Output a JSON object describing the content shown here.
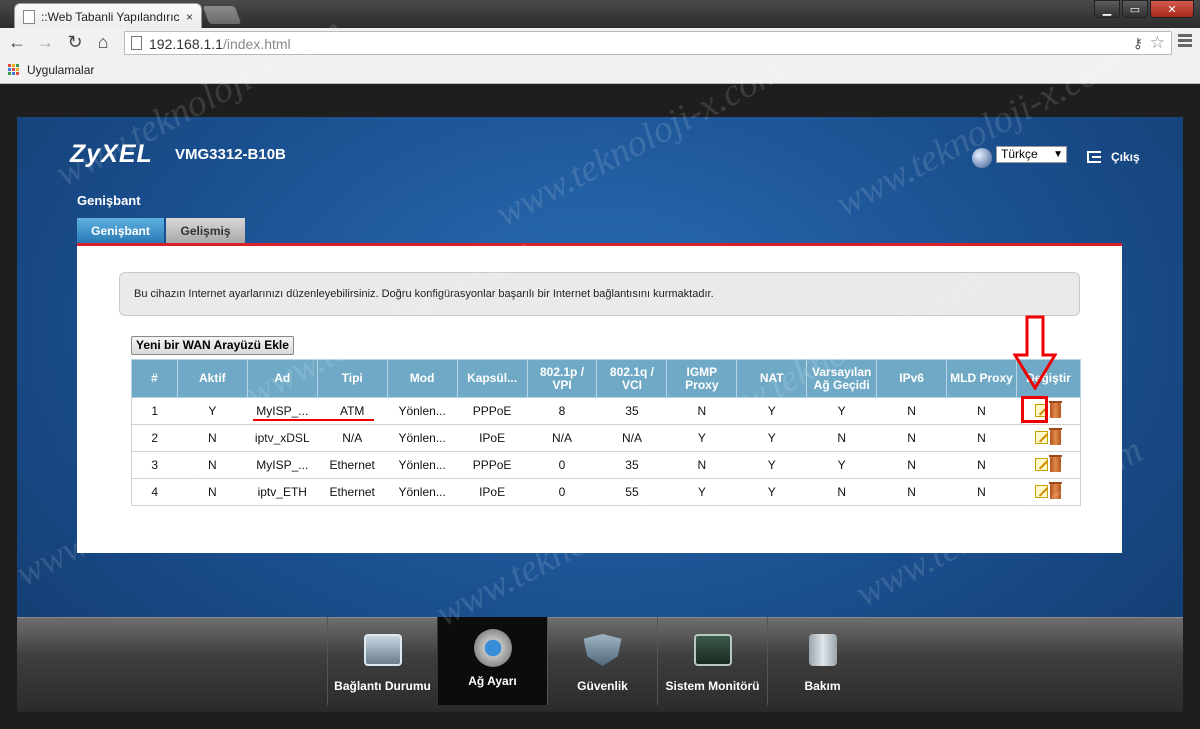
{
  "browser": {
    "tab_title": "::Web Tabanli Yapılandırıc",
    "tab_close": "×",
    "url_host": "192.168.1.1",
    "url_path": "/index.html",
    "bookmarks_label": "Uygulamalar",
    "window_buttons": [
      "▁",
      "▭",
      "✕"
    ]
  },
  "header": {
    "logo": "ZyXEL",
    "model": "VMG3312-B10B",
    "language": "Türkçe",
    "logout": "Çıkış"
  },
  "section": {
    "title": "Genişbant",
    "tabs": [
      {
        "label": "Genişbant",
        "active": true
      },
      {
        "label": "Gelişmiş",
        "active": false
      }
    ]
  },
  "notice": "Bu cihazın Internet ayarlarınızı düzenleyebilirsiniz. Doğru konfigürasyonlar başarılı bir Internet bağlantısını kurmaktadır.",
  "add_button": "Yeni bir WAN Arayüzü Ekle",
  "table": {
    "headers": [
      "#",
      "Aktif",
      "Ad",
      "Tipi",
      "Mod",
      "Kapsül...",
      "802.1p / VPI",
      "802.1q / VCI",
      "IGMP Proxy",
      "NAT",
      "Varsayılan Ağ Geçidi",
      "IPv6",
      "MLD Proxy",
      "Değiştir"
    ],
    "rows": [
      [
        "1",
        "Y",
        "MyISP_...",
        "ATM",
        "Yönlen...",
        "PPPoE",
        "8",
        "35",
        "N",
        "Y",
        "Y",
        "N",
        "N"
      ],
      [
        "2",
        "N",
        "iptv_xDSL",
        "N/A",
        "Yönlen...",
        "IPoE",
        "N/A",
        "N/A",
        "Y",
        "Y",
        "N",
        "N",
        "N"
      ],
      [
        "3",
        "N",
        "MyISP_...",
        "Ethernet",
        "Yönlen...",
        "PPPoE",
        "0",
        "35",
        "N",
        "Y",
        "Y",
        "N",
        "N"
      ],
      [
        "4",
        "N",
        "iptv_ETH",
        "Ethernet",
        "Yönlen...",
        "IPoE",
        "0",
        "55",
        "Y",
        "Y",
        "N",
        "N",
        "N"
      ]
    ]
  },
  "bottom_nav": [
    {
      "label": "Bağlantı Durumu",
      "icon": "connection-status-icon",
      "active": false
    },
    {
      "label": "Ağ Ayarı",
      "icon": "network-settings-icon",
      "active": true
    },
    {
      "label": "Güvenlik",
      "icon": "security-shield-icon",
      "active": false
    },
    {
      "label": "Sistem Monitörü",
      "icon": "system-monitor-icon",
      "active": false
    },
    {
      "label": "Bakım",
      "icon": "maintenance-icon",
      "active": false
    }
  ],
  "watermark": "www.teknoloji-x.com",
  "colors": {
    "brand_blue": "#1a4f8e",
    "accent_red": "#d6202a",
    "table_header": "#6fa9c6",
    "annotation_red": "#e00000"
  }
}
